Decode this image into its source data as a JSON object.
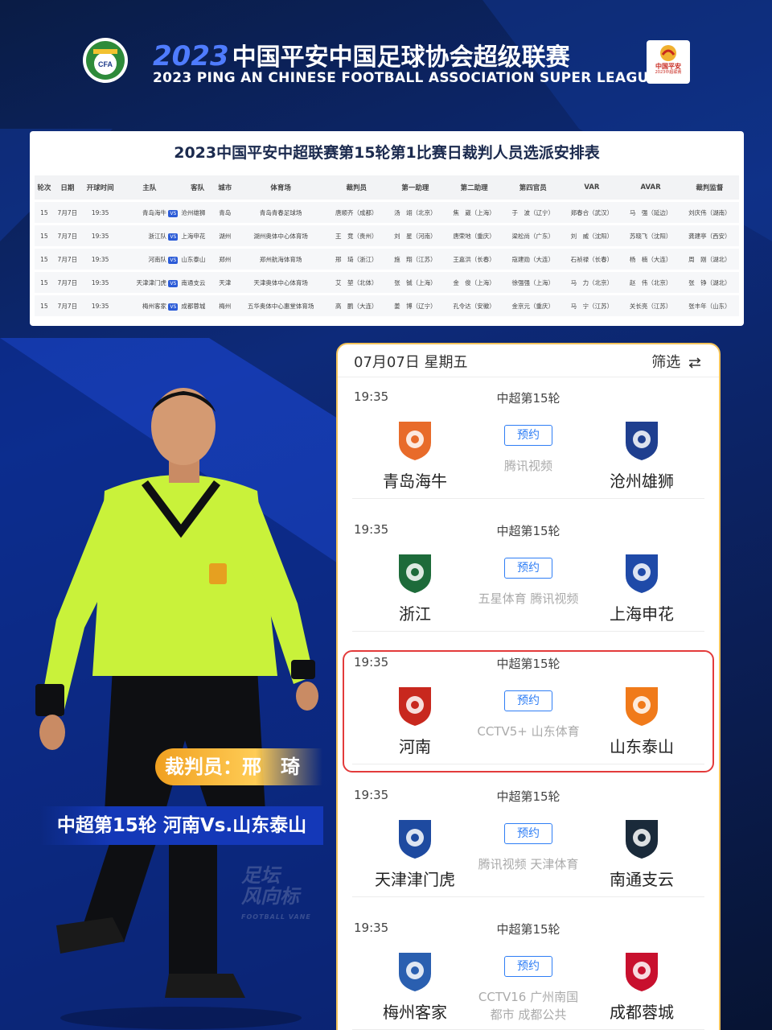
{
  "header": {
    "title_year": "2023",
    "title_cn": "中国平安中国足球协会超级联赛",
    "title_en": "2023 PING AN CHINESE FOOTBALL ASSOCIATION SUPER LEAGUE",
    "cfa_logo_text": "CFA",
    "csl_logo_text": "中国平安",
    "csl_logo_sub": "2023中超联赛"
  },
  "referee_table": {
    "title": "2023中国平安中超联赛第15轮第1比赛日裁判人员选派安排表",
    "columns": [
      "轮次",
      "日期",
      "开球时间",
      "主队",
      "客队",
      "城市",
      "体育场",
      "裁判员",
      "第一助理",
      "第二助理",
      "第四官员",
      "VAR",
      "AVAR",
      "裁判监督"
    ],
    "vs_label": "VS",
    "rows": [
      {
        "round": "15",
        "date": "7月7日",
        "time": "19:35",
        "home": "青岛海牛",
        "away": "沧州雄狮",
        "city": "青岛",
        "stadium": "青岛青春足球场",
        "referee": "唐顺齐（成都）",
        "ar1": "汤　翊（北京）",
        "ar2": "焦　崴（上海）",
        "fourth": "于　波（辽宁）",
        "var": "郑春合（武汉）",
        "avar": "马　强（延边）",
        "supervisor": "刘庆伟（湖南）"
      },
      {
        "round": "15",
        "date": "7月7日",
        "time": "19:35",
        "home": "浙江队",
        "away": "上海申花",
        "city": "湖州",
        "stadium": "湖州奥体中心体育场",
        "referee": "王　竞（贵州）",
        "ar1": "刘　星（河南）",
        "ar2": "唐荣地（重庆）",
        "fourth": "梁松尚（广东）",
        "var": "刘　威（沈阳）",
        "avar": "苏晓飞（沈阳）",
        "supervisor": "龚建亭（西安）"
      },
      {
        "round": "15",
        "date": "7月7日",
        "time": "19:35",
        "home": "河南队",
        "away": "山东泰山",
        "city": "郑州",
        "stadium": "郑州航海体育场",
        "referee": "邢　琦（浙江）",
        "ar1": "施　翔（江苏）",
        "ar2": "王嘉洪（长春）",
        "fourth": "寇建勋（大连）",
        "var": "石祯禄（长春）",
        "avar": "杨　楠（大连）",
        "supervisor": "周　刚（湖北）"
      },
      {
        "round": "15",
        "date": "7月7日",
        "time": "19:35",
        "home": "天津津门虎",
        "away": "南通支云",
        "city": "天津",
        "stadium": "天津奥体中心体育场",
        "referee": "艾　堃（北体）",
        "ar1": "张　铖（上海）",
        "ar2": "金　俊（上海）",
        "fourth": "徐强强（上海）",
        "var": "马　力（北京）",
        "avar": "赵　伟（北京）",
        "supervisor": "张　铮（湖北）"
      },
      {
        "round": "15",
        "date": "7月7日",
        "time": "19:35",
        "home": "梅州客家",
        "away": "成都蓉城",
        "city": "梅州",
        "stadium": "五华奥体中心惠堂体育场",
        "referee": "高　鹏（大连）",
        "ar1": "姜　博（辽宁）",
        "ar2": "孔令达（安徽）",
        "fourth": "金京元（重庆）",
        "var": "马　宁（江苏）",
        "avar": "关长亮（江苏）",
        "supervisor": "张丰年（山东）"
      }
    ]
  },
  "referee_feature": {
    "name_badge": "裁判员：邢　琦",
    "match_caption": "中超第15轮  河南Vs.山东泰山",
    "watermark_line1": "足坛",
    "watermark_line2": "风向标",
    "watermark_sub": "FOOTBALL VANE"
  },
  "schedule": {
    "date": "07月07日 星期五",
    "filter_label": "筛选",
    "reserve_label": "预约",
    "matches": [
      {
        "time": "19:35",
        "round": "中超第15轮",
        "home": "青岛海牛",
        "away": "沧州雄狮",
        "broadcast": "腾讯视频",
        "home_color": "#e86b2a",
        "away_color": "#1f3f8f"
      },
      {
        "time": "19:35",
        "round": "中超第15轮",
        "home": "浙江",
        "away": "上海申花",
        "broadcast": "五星体育 腾讯视频",
        "home_color": "#1d6b3a",
        "away_color": "#1f4aa8"
      },
      {
        "time": "19:35",
        "round": "中超第15轮",
        "home": "河南",
        "away": "山东泰山",
        "broadcast": "CCTV5+ 山东体育",
        "home_color": "#c8281e",
        "away_color": "#f07a1a"
      },
      {
        "time": "19:35",
        "round": "中超第15轮",
        "home": "天津津门虎",
        "away": "南通支云",
        "broadcast": "腾讯视频 天津体育",
        "home_color": "#1e4aa0",
        "away_color": "#1a2a3a"
      },
      {
        "time": "19:35",
        "round": "中超第15轮",
        "home": "梅州客家",
        "away": "成都蓉城",
        "broadcast": "CCTV16 广州南国都市 成都公共",
        "home_color": "#2a5fb0",
        "away_color": "#c8102e"
      }
    ]
  }
}
